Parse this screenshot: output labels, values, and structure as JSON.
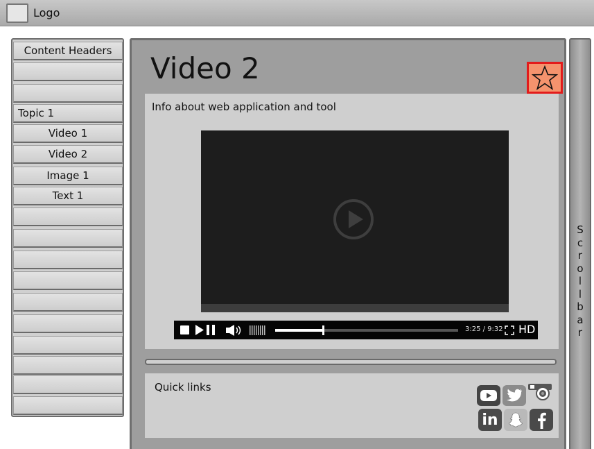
{
  "header": {
    "logo_label": "Logo"
  },
  "sidebar": {
    "items": [
      {
        "label": "Content Headers",
        "align": "center"
      },
      {
        "label": "",
        "align": "center"
      },
      {
        "label": "",
        "align": "center"
      },
      {
        "label": "Topic 1",
        "align": "left"
      },
      {
        "label": "Video 1",
        "align": "center"
      },
      {
        "label": "Video 2",
        "align": "center"
      },
      {
        "label": "Image 1",
        "align": "center"
      },
      {
        "label": "Text 1",
        "align": "center"
      },
      {
        "label": "",
        "align": "center"
      },
      {
        "label": "",
        "align": "center"
      },
      {
        "label": "",
        "align": "center"
      },
      {
        "label": "",
        "align": "center"
      },
      {
        "label": "",
        "align": "center"
      },
      {
        "label": "",
        "align": "center"
      },
      {
        "label": "",
        "align": "center"
      },
      {
        "label": "",
        "align": "center"
      },
      {
        "label": "",
        "align": "center"
      },
      {
        "label": "",
        "align": "center"
      }
    ]
  },
  "main": {
    "title": "Video 2",
    "favorite_icon": "star-icon",
    "favorite_colors": {
      "fill": "#f5936d",
      "border": "#e31b1b"
    },
    "info_text": "Info about web application and tool",
    "video": {
      "play_icon": "play-circle-icon",
      "time": "3:25 / 9:32",
      "hd_label": "HD",
      "progress": 0.26
    },
    "quick_links": {
      "label": "Quick links",
      "icons": [
        "youtube-icon",
        "twitter-icon",
        "instagram-icon",
        "linkedin-icon",
        "snapchat-icon",
        "facebook-icon"
      ]
    }
  },
  "scrollbar": {
    "letters": [
      "S",
      "c",
      "r",
      "o",
      "l",
      "l",
      "b",
      "a",
      "r"
    ]
  }
}
